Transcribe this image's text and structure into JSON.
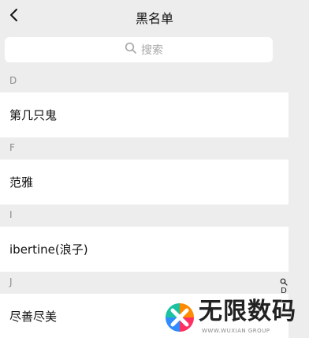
{
  "nav": {
    "back_icon": "chevron-left-icon",
    "title": "黑名单"
  },
  "search": {
    "icon": "search-icon",
    "placeholder": "搜索"
  },
  "sections": [
    {
      "label": "D",
      "contacts": [
        {
          "name": "第几只鬼"
        }
      ]
    },
    {
      "label": "F",
      "contacts": [
        {
          "name": "范雅"
        }
      ]
    },
    {
      "label": "I",
      "contacts": [
        {
          "name": "ibertine(浪子)"
        }
      ]
    },
    {
      "label": "J",
      "contacts": [
        {
          "name": "尽善尽美"
        }
      ]
    }
  ],
  "index_bar": {
    "search_icon": "search-icon",
    "current_letter": "D"
  },
  "watermark": {
    "title": "无限数码",
    "subtitle": "WWW.WUXIAN GROUP",
    "logo_icon": "wuxian-logo-icon"
  },
  "colors": {
    "background": "#ededed",
    "row_background": "#ffffff",
    "section_text": "#8c8c8c",
    "primary_text": "#111111",
    "placeholder_text": "#a7a7a7"
  }
}
